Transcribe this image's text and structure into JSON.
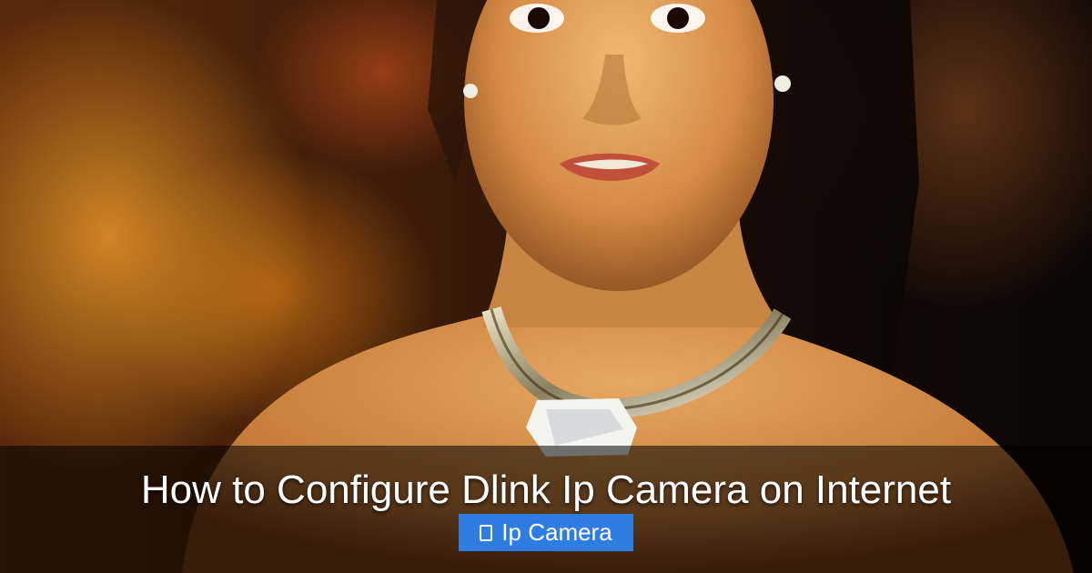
{
  "hero": {
    "image_subject": "background-photo"
  },
  "headline": {
    "title": "How to Configure Dlink Ip Camera on Internet"
  },
  "tag": {
    "label": "Ip Camera",
    "icon": "tag-icon",
    "color": "#2f7de1"
  }
}
